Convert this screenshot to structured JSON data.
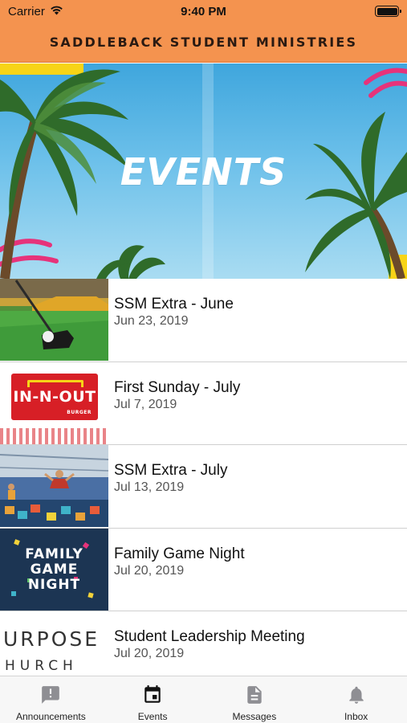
{
  "status_bar": {
    "carrier": "Carrier",
    "time": "9:40 PM",
    "battery_level": 1.0
  },
  "header": {
    "title": "SADDLEBACK STUDENT MINISTRIES",
    "background_color": "#f4934f"
  },
  "hero": {
    "title": "EVENTS"
  },
  "events": [
    {
      "title": "SSM Extra - June",
      "date": "Jun 23, 2019",
      "thumbnail": "mini-golf-photo"
    },
    {
      "title": "First Sunday - July",
      "date": "Jul 7, 2019",
      "thumbnail": "in-n-out-logo",
      "thumbnail_text": "IN-N-OUT",
      "thumbnail_subtext": "BURGER"
    },
    {
      "title": "SSM Extra - July",
      "date": "Jul 13, 2019",
      "thumbnail": "trampoline-park-photo"
    },
    {
      "title": "Family Game Night",
      "date": "Jul 20, 2019",
      "thumbnail": "family-game-night-graphic",
      "thumbnail_lines": [
        "FAMILY",
        "GAME",
        "NIGHT"
      ]
    },
    {
      "title": "Student Leadership Meeting",
      "date": "Jul 20, 2019",
      "thumbnail": "purpose-church-logo",
      "thumbnail_lines": [
        "URPOSE",
        "HURCH"
      ]
    }
  ],
  "tab_bar": {
    "tabs": [
      {
        "label": "Announcements",
        "icon": "announcement-icon",
        "active": false
      },
      {
        "label": "Events",
        "icon": "calendar-icon",
        "active": true
      },
      {
        "label": "Messages",
        "icon": "document-icon",
        "active": false
      },
      {
        "label": "Inbox",
        "icon": "bell-icon",
        "active": false
      }
    ]
  }
}
